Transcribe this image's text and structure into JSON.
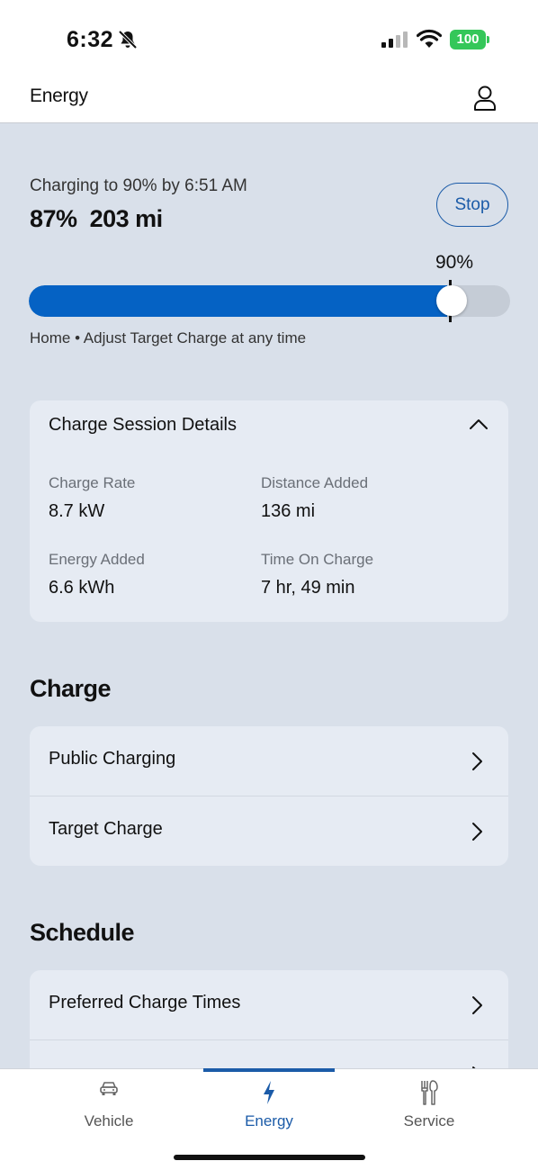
{
  "status_bar": {
    "time": "6:32",
    "battery": "100"
  },
  "header": {
    "title": "Energy"
  },
  "charging": {
    "status_text": "Charging to 90% by 6:51 AM",
    "battery_percent": "87%",
    "range": "203 mi",
    "stop_label": "Stop",
    "target_label": "90%",
    "progress_fraction": 0.87,
    "target_fraction": 0.9,
    "caption": "Home • Adjust Target Charge at any time"
  },
  "session": {
    "title": "Charge Session Details",
    "stats": [
      {
        "label": "Charge Rate",
        "value": "8.7 kW"
      },
      {
        "label": "Distance Added",
        "value": "136 mi"
      },
      {
        "label": "Energy Added",
        "value": "6.6 kWh"
      },
      {
        "label": "Time On Charge",
        "value": "7 hr, 49 min"
      }
    ]
  },
  "charge_section": {
    "heading": "Charge",
    "items": [
      {
        "label": "Public Charging"
      },
      {
        "label": "Target Charge"
      }
    ]
  },
  "schedule_section": {
    "heading": "Schedule",
    "items": [
      {
        "label": "Preferred Charge Times"
      },
      {
        "label": ""
      }
    ]
  },
  "bottom_nav": {
    "items": [
      {
        "label": "Vehicle",
        "icon": "car-icon"
      },
      {
        "label": "Energy",
        "icon": "lightning-icon"
      },
      {
        "label": "Service",
        "icon": "tools-icon"
      }
    ],
    "active": "Energy"
  },
  "colors": {
    "accent": "#0562c4",
    "nav_active": "#1b5ba8",
    "battery": "#34c759",
    "background": "#d9e0ea",
    "card": "#e6ebf3"
  }
}
